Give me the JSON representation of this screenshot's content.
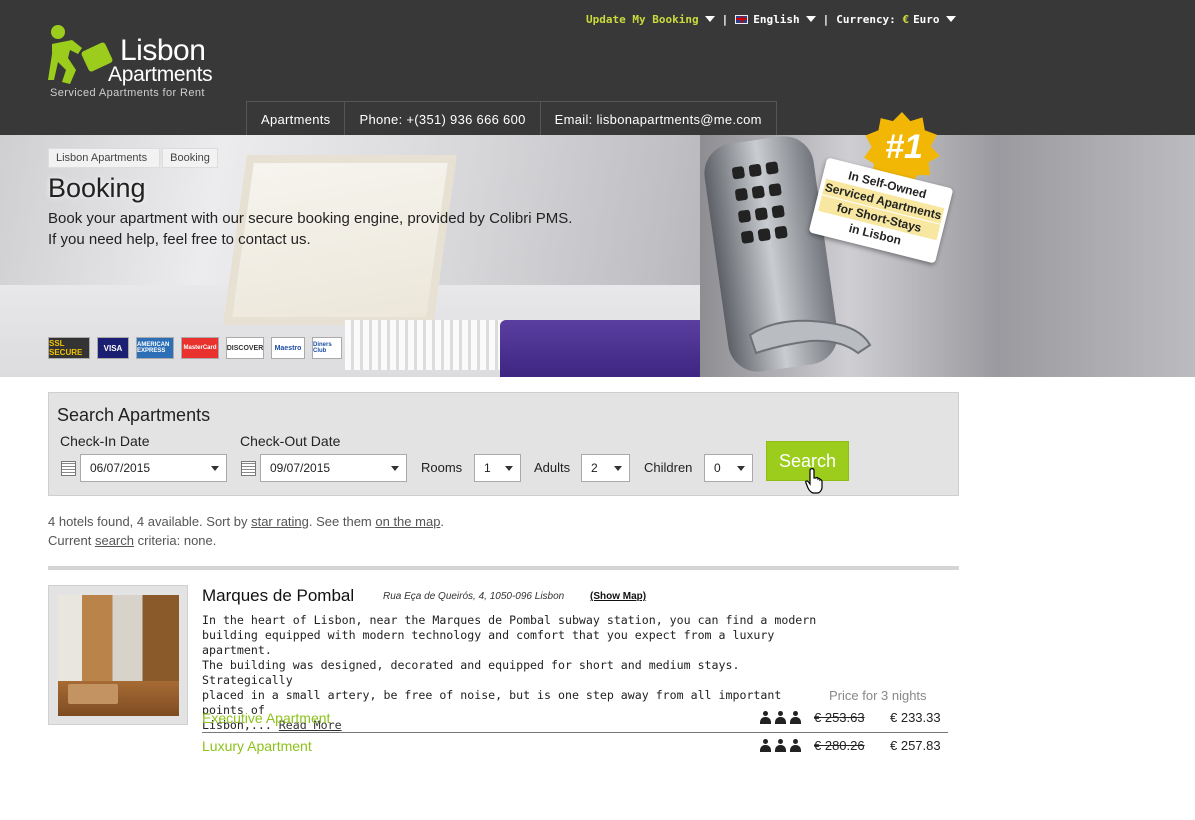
{
  "brand": {
    "name_line1": "Lisbon",
    "name_line2": "Apartments",
    "tagline": "Serviced Apartments for Rent"
  },
  "topbar": {
    "update_booking": "Update My Booking",
    "language": "English",
    "currency_label": "Currency:",
    "currency_symbol": "€",
    "currency_value": "Euro"
  },
  "nav": {
    "apartments": "Apartments",
    "phone": "Phone: +(351) 936 666 600",
    "email": "Email: lisbonapartments@me.com"
  },
  "breadcrumb": [
    "Lisbon Apartments",
    "Booking"
  ],
  "hero": {
    "title": "Booking",
    "desc_line1": "Book your apartment with our secure booking engine, provided by Colibri PMS.",
    "desc_line2": "If you need help, feel free to contact us.",
    "badge_number": "#1",
    "badge_lines": [
      "In Self-Owned",
      "Serviced Apartments",
      "for Short-Stays",
      "in Lisbon"
    ]
  },
  "payments": [
    "SSL SECURE",
    "VISA",
    "AMERICAN EXPRESS",
    "MasterCard",
    "DISCOVER",
    "Maestro",
    "Diners Club"
  ],
  "search": {
    "title": "Search Apartments",
    "checkin_label": "Check-In Date",
    "checkin_value": "06/07/2015",
    "checkout_label": "Check-Out Date",
    "checkout_value": "09/07/2015",
    "rooms_label": "Rooms",
    "rooms_value": "1",
    "adults_label": "Adults",
    "adults_value": "2",
    "children_label": "Children",
    "children_value": "0",
    "button": "Search"
  },
  "results": {
    "line1_prefix": "4 hotels found, 4 available. Sort by ",
    "sort_link": "star rating",
    "line1_mid": ". See them ",
    "map_link": "on the map",
    "line1_end": ".",
    "line2_prefix": "Current ",
    "search_link": "search",
    "line2_end": " criteria: none."
  },
  "hotel": {
    "name": "Marques de Pombal",
    "address": "Rua Eça de Queirós, 4, 1050-096 Lisbon",
    "show_map": "(Show Map)",
    "description_lines": [
      "In the heart of Lisbon, near the Marques de Pombal subway station, you can find a modern",
      "building equipped with modern technology and comfort that you expect from a luxury apartment.",
      "The building was designed, decorated and equipped for short and medium stays. Strategically",
      "placed in a small artery, be free of noise, but is one step away from all important points of"
    ],
    "description_tail": "Lisbon,... ",
    "read_more": "Read More",
    "price_note": "Price for 3 nights",
    "rooms": [
      {
        "name": "Executive Apartment",
        "guests": 3,
        "old_price": "€ 253.63",
        "new_price": "€ 233.33"
      },
      {
        "name": "Luxury Apartment",
        "guests": 3,
        "old_price": "€ 280.26",
        "new_price": "€ 257.83"
      }
    ]
  },
  "colors": {
    "header_bg": "#383838",
    "accent_green": "#9ccd1d",
    "room_link_green": "#8cc21a",
    "badge_gold": "#f2b705"
  }
}
